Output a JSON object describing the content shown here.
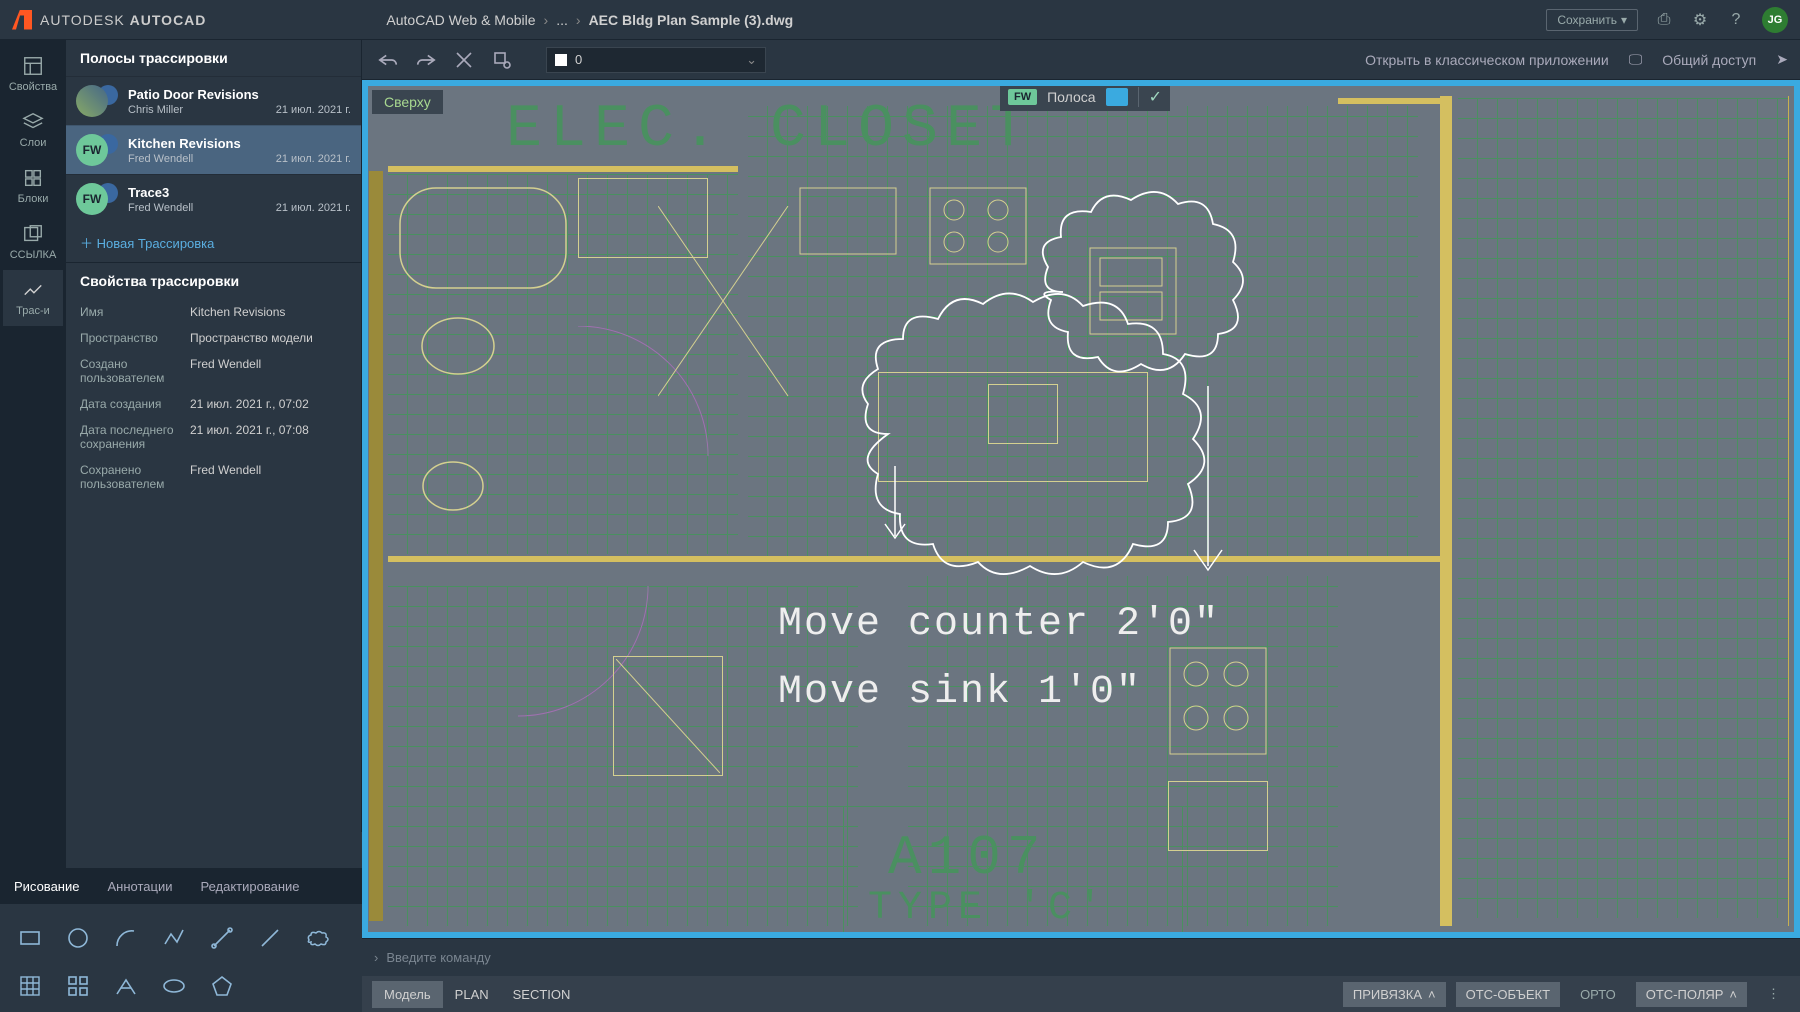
{
  "header": {
    "brand_prefix": "AUTODESK",
    "brand_name": "AUTOCAD",
    "breadcrumb_root": "AutoCAD Web & Mobile",
    "breadcrumb_mid": "...",
    "breadcrumb_file": "AEC Bldg Plan Sample (3).dwg",
    "save_label": "Сохранить",
    "user_initials": "JG"
  },
  "toolbar": {
    "layer_value": "0",
    "open_classic": "Открыть в классическом приложении",
    "share": "Общий доступ"
  },
  "left_rail": {
    "properties": "Свойства",
    "layers": "Слои",
    "blocks": "Блоки",
    "reference": "ССЫЛКА",
    "traces": "Трас-и"
  },
  "panel": {
    "title": "Полосы трассировки",
    "traces": [
      {
        "name": "Patio Door Revisions",
        "author": "Chris Miller",
        "date": "21 июл. 2021 г.",
        "initials": "",
        "color": "#6a88a0"
      },
      {
        "name": "Kitchen Revisions",
        "author": "Fred Wendell",
        "date": "21 июл. 2021 г.",
        "initials": "FW",
        "color": "#6ec89a"
      },
      {
        "name": "Trace3",
        "author": "Fred Wendell",
        "date": "21 июл. 2021 г.",
        "initials": "FW",
        "color": "#6ec89a"
      }
    ],
    "new_trace": "Новая Трассировка",
    "props_title": "Свойства трассировки",
    "props": {
      "name_lbl": "Имя",
      "name_val": "Kitchen Revisions",
      "space_lbl": "Пространство",
      "space_val": "Пространство модели",
      "created_by_lbl": "Создано пользователем",
      "created_by_val": "Fred Wendell",
      "created_date_lbl": "Дата создания",
      "created_date_val": "21 июл. 2021 г., 07:02",
      "saved_date_lbl": "Дата последнего сохранения",
      "saved_date_val": "21 июл. 2021 г., 07:08",
      "saved_by_lbl": "Сохранено пользователем",
      "saved_by_val": "Fred Wendell"
    }
  },
  "tool_tabs": {
    "draw": "Рисование",
    "annotate": "Аннотации",
    "edit": "Редактирование"
  },
  "canvas": {
    "view_label": "Сверху",
    "trace_badge_initials": "FW",
    "trace_badge_label": "Полоса",
    "elec_text": "ELEC. CLOSET",
    "annot_line1": "Move counter 2'0\"",
    "annot_line2": "Move sink 1'0\"",
    "a107": "A107",
    "type_c": "TYPE 'C'"
  },
  "cmdline": {
    "placeholder": "Введите команду"
  },
  "status": {
    "model": "Модель",
    "plan": "PLAN",
    "section": "SECTION",
    "snap": "ПРИВЯЗКА",
    "osnap": "ОТС-ОБЪЕКТ",
    "ortho": "ОРТО",
    "polar": "ОТС-ПОЛЯР"
  }
}
